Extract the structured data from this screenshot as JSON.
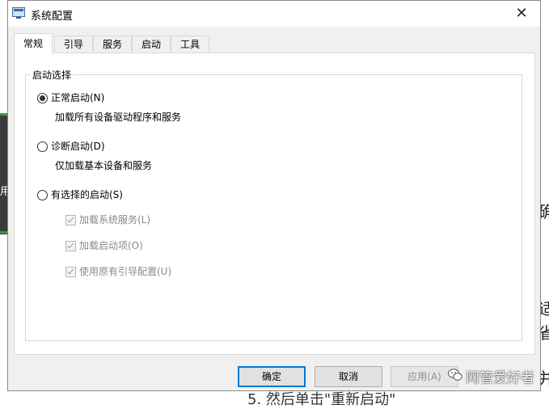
{
  "background": {
    "right_snippets": [
      "确",
      "适",
      "省",
      "并"
    ],
    "left_glyph": "用",
    "bottom_text": "5. 然后单击\"重新启动\""
  },
  "dialog": {
    "title": "系统配置",
    "close_symbol": "✕",
    "tabs": [
      {
        "label": "常规",
        "active": true
      },
      {
        "label": "引导",
        "active": false
      },
      {
        "label": "服务",
        "active": false
      },
      {
        "label": "启动",
        "active": false
      },
      {
        "label": "工具",
        "active": false
      }
    ],
    "startup": {
      "group_label": "启动选择",
      "normal": {
        "label": "正常启动(N)",
        "desc": "加载所有设备驱动程序和服务",
        "checked": true
      },
      "diagnostic": {
        "label": "诊断启动(D)",
        "desc": "仅加载基本设备和服务",
        "checked": false
      },
      "selective": {
        "label": "有选择的启动(S)",
        "checked": false,
        "options": [
          {
            "label": "加载系统服务(L)",
            "checked": true,
            "enabled": false
          },
          {
            "label": "加载启动项(O)",
            "checked": true,
            "enabled": false
          },
          {
            "label": "使用原有引导配置(U)",
            "checked": true,
            "enabled": false
          }
        ]
      }
    },
    "buttons": {
      "ok": "确定",
      "cancel": "取消",
      "apply": "应用(A)"
    }
  },
  "watermark": {
    "text": "网管爱好者",
    "icon": "wechat-icon"
  }
}
